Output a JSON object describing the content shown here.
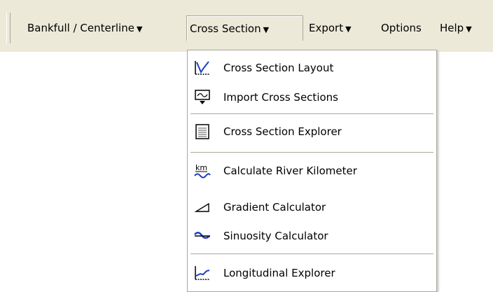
{
  "menubar": {
    "items": [
      {
        "label": "Bankfull / Centerline",
        "arrow": "▼"
      },
      {
        "label": "Cross Section",
        "arrow": "▼"
      },
      {
        "label": "Export",
        "arrow": "▼"
      },
      {
        "label": "Options",
        "arrow": ""
      },
      {
        "label": "Help",
        "arrow": "▼"
      }
    ]
  },
  "dropdown": {
    "items": [
      {
        "label": "Cross Section Layout",
        "icon": "cross-section-layout-icon"
      },
      {
        "label": "Import Cross Sections",
        "icon": "import-cross-sections-icon"
      },
      {
        "label": "Cross Section Explorer",
        "icon": "cross-section-explorer-icon"
      },
      {
        "label": "Calculate River Kilometer",
        "icon": "river-kilometer-icon"
      },
      {
        "label": "Gradient Calculator",
        "icon": "gradient-icon"
      },
      {
        "label": "Sinuosity Calculator",
        "icon": "sinuosity-icon"
      },
      {
        "label": "Longitudinal Explorer",
        "icon": "longitudinal-explorer-icon"
      }
    ],
    "km_icon_text": "km"
  }
}
